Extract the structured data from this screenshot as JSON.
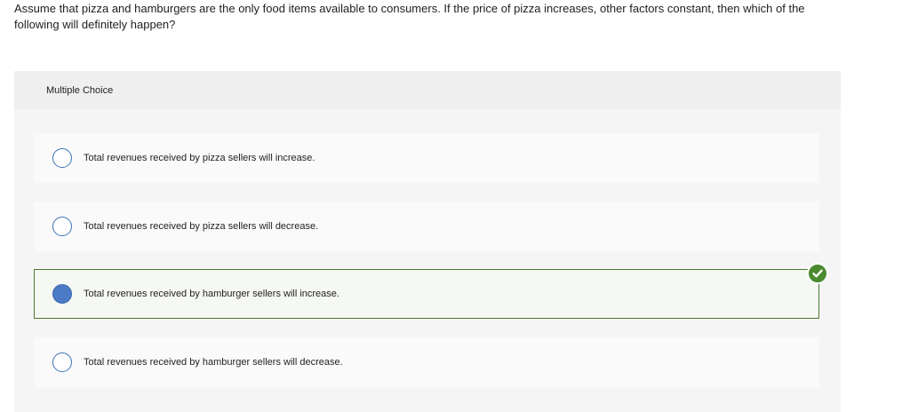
{
  "question": {
    "text": "Assume that pizza and hamburgers are the only food items available to consumers. If the price of pizza increases, other factors constant, then which of the following will definitely happen?"
  },
  "panel": {
    "title": "Multiple Choice"
  },
  "options": [
    {
      "label": "Total revenues received by pizza sellers will increase.",
      "selected": false
    },
    {
      "label": "Total revenues received by pizza sellers will decrease.",
      "selected": false
    },
    {
      "label": "Total revenues received by hamburger sellers will increase.",
      "selected": true,
      "status": "correct"
    },
    {
      "label": "Total revenues received by hamburger sellers will decrease.",
      "selected": false
    }
  ],
  "icons": {
    "correct": "checkmark-icon",
    "radio": "radio-button"
  },
  "colors": {
    "radio_border": "#3a73b5",
    "radio_selected_fill": "#4a7bc4",
    "correct_green": "#4b8a2f",
    "selected_border": "#4b7a32"
  }
}
